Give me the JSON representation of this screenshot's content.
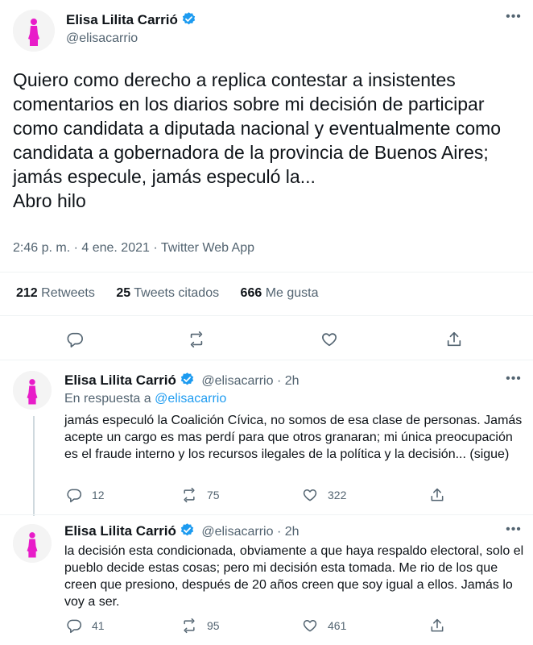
{
  "main_tweet": {
    "author_name": "Elisa Lilita Carrió",
    "handle": "@elisacarrio",
    "text": "Quiero como derecho a replica contestar a insistentes comentarios en los diarios sobre mi decisión de participar como candidata a diputada nacional y eventualmente como candidata a gobernadora de la provincia de Buenos Aires; jamás especule, jamás especuló la...\nAbro hilo",
    "meta": "2:46 p. m. · 4 ene. 2021 · Twitter Web App",
    "stats": {
      "retweets_count": "212",
      "retweets_label": "Retweets",
      "quotes_count": "25",
      "quotes_label": "Tweets citados",
      "likes_count": "666",
      "likes_label": "Me gusta"
    }
  },
  "replies": [
    {
      "author_name": "Elisa Lilita Carrió",
      "handle_time": "@elisacarrio · 2h",
      "reply_to_prefix": "En respuesta a",
      "reply_to_handle": "@elisacarrio",
      "text": "jamás especuló la Coalición Cívica, no somos de esa clase de personas. Jamás acepte un cargo es mas perdí para que otros granaran; mi única preocupación es el fraude interno y los recursos ilegales de la política y la decisión... (sigue)",
      "reply_count": "12",
      "retweet_count": "75",
      "like_count": "322"
    },
    {
      "author_name": "Elisa Lilita Carrió",
      "handle_time": "@elisacarrio · 2h",
      "text": "la decisión esta condicionada, obviamente a que haya respaldo electoral, solo el pueblo decide estas cosas; pero mi decisión esta tomada. Me rio de los que creen que presiono, después de 20 años creen que soy igual a ellos. Jamás lo voy a ser.",
      "reply_count": "41",
      "retweet_count": "95",
      "like_count": "461"
    }
  ],
  "colors": {
    "accent": "#1d9bf0",
    "verified": "#1d9bf0",
    "avatar_figure": "#e81cc9",
    "secondary_text": "#536471"
  }
}
